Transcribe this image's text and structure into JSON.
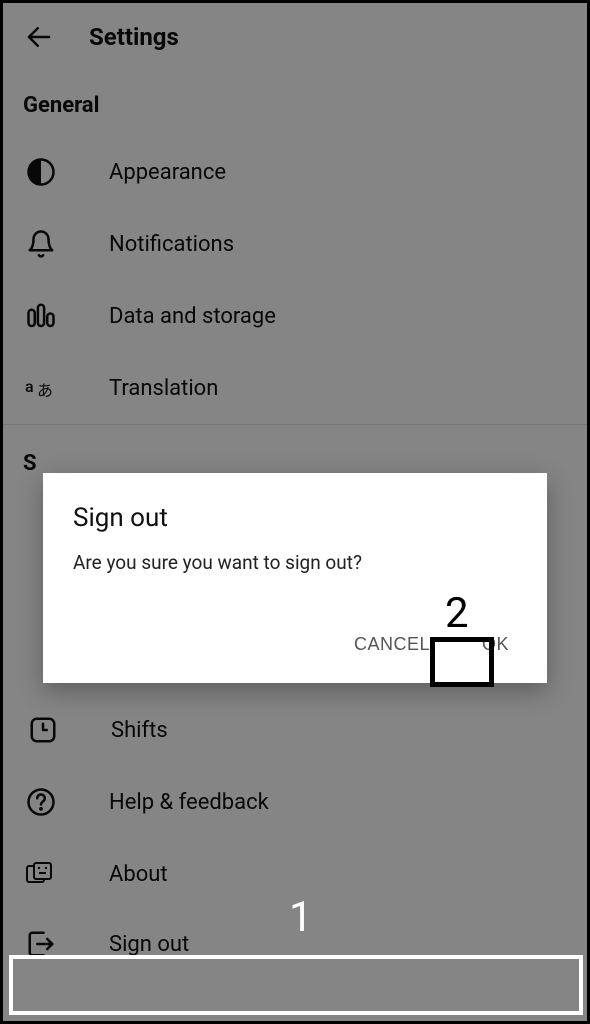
{
  "header": {
    "title": "Settings"
  },
  "sections": {
    "general": {
      "title": "General",
      "items": {
        "appearance": "Appearance",
        "notifications": "Notifications",
        "data_storage": "Data and storage",
        "translation": "Translation"
      }
    },
    "second": {
      "title": "S",
      "items": {
        "shifts": "Shifts",
        "help": "Help & feedback",
        "about": "About",
        "signout": "Sign out"
      }
    }
  },
  "dialog": {
    "title": "Sign out",
    "message": "Are you sure you want to sign out?",
    "cancel": "CANCEL",
    "ok": "OK"
  },
  "annotations": {
    "one": "1",
    "two": "2"
  }
}
